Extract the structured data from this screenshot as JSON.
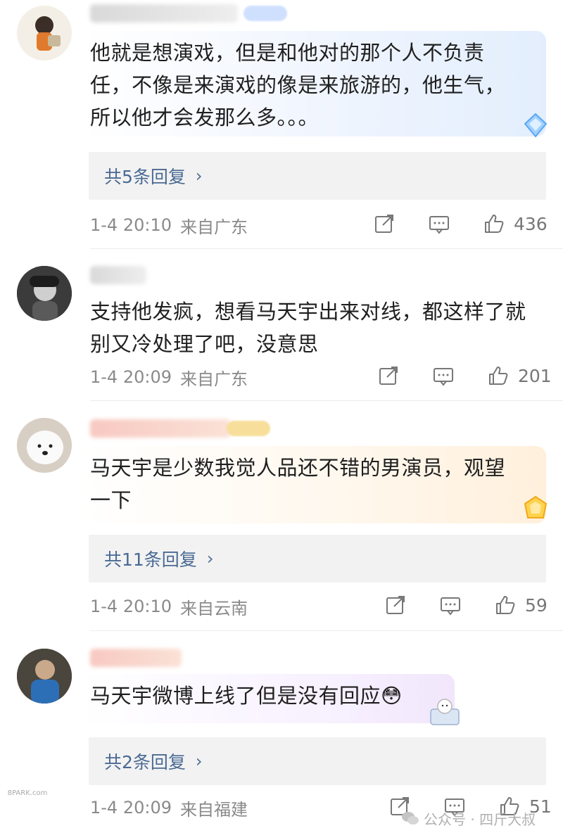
{
  "comments": [
    {
      "text": "他就是想演戏，但是和他对的那个人不负责\n任，不像是来演戏的像是来旅游的，他生气，\n所以他才会发那么多。。。",
      "replies_label": "共5条回复",
      "time": "1-4 20:10",
      "location": "来自广东",
      "likes": "436"
    },
    {
      "text": "支持他发疯，想看马天宇出来对线，都这样了就\n别又冷处理了吧，没意思",
      "time": "1-4 20:09",
      "location": "来自广东",
      "likes": "201"
    },
    {
      "text": "马天宇是少数我觉人品还不错的男演员，观望\n一下",
      "replies_label": "共11条回复",
      "time": "1-4 20:10",
      "location": "来自云南",
      "likes": "59"
    },
    {
      "text": "马天宇微博上线了但是没有回应😳",
      "replies_label": "共2条回复",
      "time": "1-4 20:09",
      "location": "来自福建",
      "likes": "51"
    }
  ],
  "icons": {
    "share": "share-icon",
    "comment": "comment-icon",
    "like": "like-icon",
    "chevron": "chevron-right-icon"
  },
  "colors": {
    "reply_link": "#4a6a94",
    "meta_gray": "#8a8a8a",
    "reply_box_bg": "#f2f2f2"
  },
  "watermark": {
    "left": "8PARK.com",
    "right": "公众号 · 四斤大叔"
  }
}
